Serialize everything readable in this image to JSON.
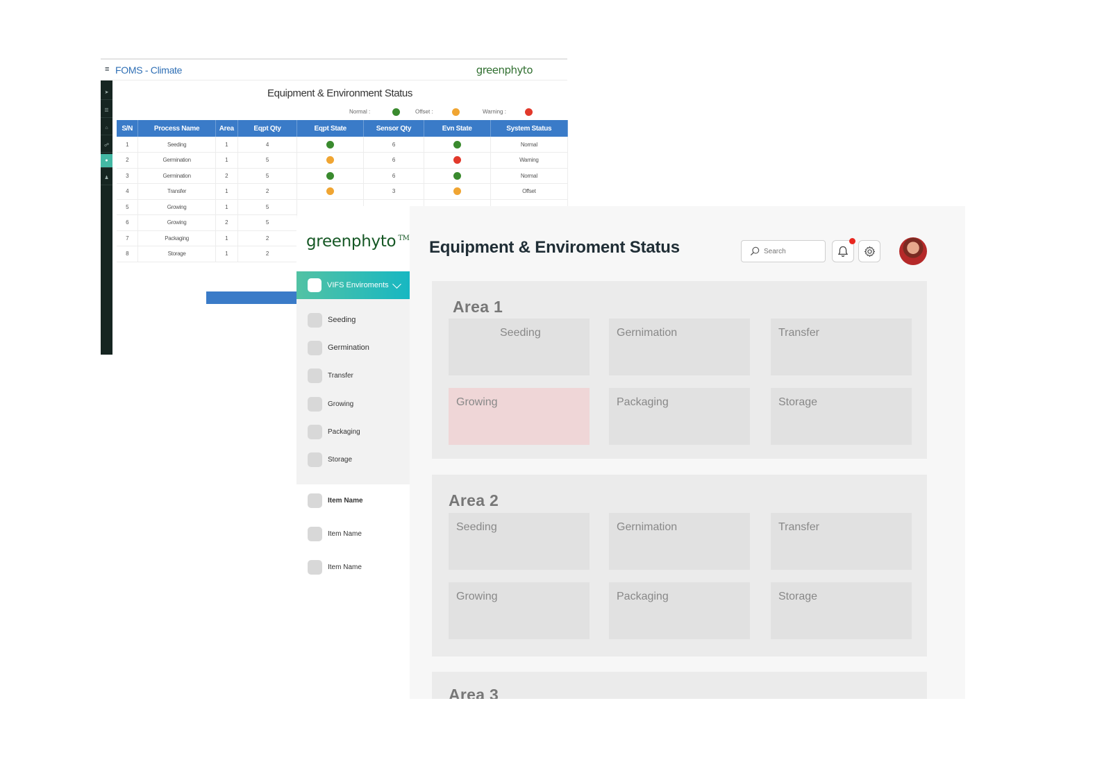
{
  "old_screen": {
    "app_title": "FOMS - Climate",
    "brand": "greenphyto",
    "page_title": "Equipment & Environment Status",
    "legend": [
      {
        "label": "Normal :",
        "color": "#3a8a2e"
      },
      {
        "label": "Offset :",
        "color": "#f0a532"
      },
      {
        "label": "Warning :",
        "color": "#e2392b"
      }
    ],
    "table": {
      "columns": [
        "S/N",
        "Process Name",
        "Area",
        "Eqpt Qty",
        "Eqpt State",
        "Sensor Qty",
        "Evn State",
        "System Status"
      ],
      "rows": [
        {
          "sn": "1",
          "process": "Seeding",
          "area": "1",
          "eqpt_qty": "4",
          "eqpt_state": "#3a8a2e",
          "sensor_qty": "6",
          "evn_state": "#3a8a2e",
          "status": "Normal"
        },
        {
          "sn": "2",
          "process": "Germination",
          "area": "1",
          "eqpt_qty": "5",
          "eqpt_state": "#f0a532",
          "sensor_qty": "6",
          "evn_state": "#e2392b",
          "status": "Warning"
        },
        {
          "sn": "3",
          "process": "Germination",
          "area": "2",
          "eqpt_qty": "5",
          "eqpt_state": "#3a8a2e",
          "sensor_qty": "6",
          "evn_state": "#3a8a2e",
          "status": "Normal"
        },
        {
          "sn": "4",
          "process": "Transfer",
          "area": "1",
          "eqpt_qty": "2",
          "eqpt_state": "#f0a532",
          "sensor_qty": "3",
          "evn_state": "#f0a532",
          "status": "Offset"
        },
        {
          "sn": "5",
          "process": "Growing",
          "area": "1",
          "eqpt_qty": "5",
          "eqpt_state": "",
          "sensor_qty": "",
          "evn_state": "",
          "status": ""
        },
        {
          "sn": "6",
          "process": "Growing",
          "area": "2",
          "eqpt_qty": "5",
          "eqpt_state": "",
          "sensor_qty": "",
          "evn_state": "",
          "status": ""
        },
        {
          "sn": "7",
          "process": "Packaging",
          "area": "1",
          "eqpt_qty": "2",
          "eqpt_state": "",
          "sensor_qty": "",
          "evn_state": "",
          "status": ""
        },
        {
          "sn": "8",
          "process": "Storage",
          "area": "1",
          "eqpt_qty": "2",
          "eqpt_state": "",
          "sensor_qty": "",
          "evn_state": "",
          "status": ""
        }
      ]
    }
  },
  "sidebar": {
    "logo": "greenphyto",
    "logo_tm": "TM",
    "env_header": "VIFS Enviroments",
    "env_items": [
      "Seeding",
      "Germination",
      "Transfer",
      "Growing",
      "Packaging",
      "Storage"
    ],
    "extra_items": [
      "Item Name",
      "Item Name",
      "Item Name"
    ]
  },
  "header": {
    "title": "Equipment & Enviroment Status",
    "search_placeholder": "Search"
  },
  "areas": [
    {
      "title": "Area 1",
      "tiles": [
        "Seeding",
        "Gernimation",
        "Transfer",
        "Growing",
        "Packaging",
        "Storage"
      ],
      "alert_tile": "Growing"
    },
    {
      "title": "Area 2",
      "tiles": [
        "Seeding",
        "Gernimation",
        "Transfer",
        "Growing",
        "Packaging",
        "Storage"
      ],
      "alert_tile": ""
    },
    {
      "title": "Area 3",
      "tiles": [],
      "alert_tile": ""
    }
  ],
  "colors": {
    "accent_from": "#52c2a4",
    "accent_to": "#17b7c2",
    "alert_tile": "#efd6d7",
    "table_header": "#3a7bc8"
  }
}
